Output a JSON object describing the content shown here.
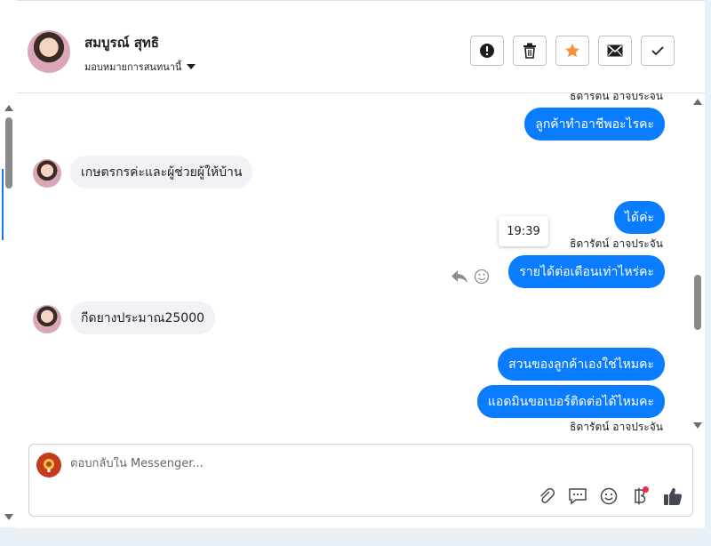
{
  "header": {
    "contact_name": "สมบูรณ์ สุทธิ",
    "assign_label": "มอบหมายการสนทนานี้",
    "actions": [
      "alert-icon",
      "trash-icon",
      "star-icon",
      "mail-icon",
      "check-icon"
    ]
  },
  "thread": {
    "top_sender_label": "ธิดารัตน์ อาจประจัน",
    "messages": [
      {
        "direction": "out",
        "text": "ลูกค้าทำอาชีพอะไรคะ"
      },
      {
        "direction": "in",
        "text": "เกษตรกรค่ะและผู้ช่วยผู้ให้บ้าน"
      },
      {
        "direction": "out",
        "text": "ได้ค่ะ",
        "sender": "ธิดารัตน์ อาจประจัน"
      },
      {
        "direction": "out",
        "text": "รายได้ต่อเดือนเท่าไหร่คะ",
        "tooltip": "19:39"
      },
      {
        "direction": "in",
        "text": "กีดยางประมาณ25000"
      },
      {
        "direction": "out",
        "text": "สวนของลูกค้าเองใช่ไหมคะ"
      },
      {
        "direction": "out",
        "text": "แอดมินขอเบอร์ติดต่อได้ไหมคะ",
        "sender": "ธิดารัตน์ อาจประจัน"
      }
    ]
  },
  "composer": {
    "placeholder": "ตอบกลับใน Messenger...",
    "tools": [
      "attachment-icon",
      "saved-reply-icon",
      "emoji-icon",
      "baht-payment-icon",
      "thumbs-up-icon"
    ]
  },
  "colors": {
    "accent": "#0a7cff",
    "incoming_bubble": "#f0f2f5",
    "star": "#f7923b",
    "notification": "#f02849"
  }
}
